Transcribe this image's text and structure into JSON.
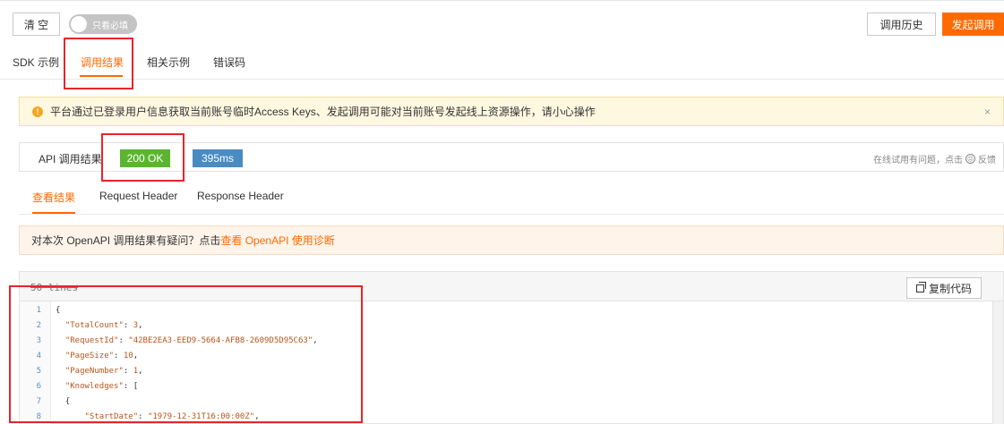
{
  "toolbar": {
    "clear_label": "清 空",
    "toggle_label": "只看必填",
    "history_label": "调用历史",
    "invoke_label": "发起调用"
  },
  "main_tabs": [
    "SDK 示例",
    "调用结果",
    "相关示例",
    "错误码"
  ],
  "warning": {
    "text": "平台通过已登录用户信息获取当前账号临时Access Keys、发起调用可能对当前账号发起线上资源操作，请小心操作",
    "close": "×"
  },
  "result": {
    "label": "API 调用结果",
    "status": "200 OK",
    "duration": "395ms",
    "feedback_prefix": "在线试用有问题，点击",
    "feedback_link": "反馈"
  },
  "sub_tabs": [
    "查看结果",
    "Request Header",
    "Response Header"
  ],
  "diagnosis": {
    "text": "对本次 OpenAPI 调用结果有疑问？点击",
    "link": "查看 OpenAPI 使用诊断"
  },
  "code": {
    "lines_label": "50 lines",
    "copy_label": "复制代码",
    "lines": [
      {
        "num": "1",
        "text": "{"
      },
      {
        "num": "2",
        "key": "\"TotalCount\"",
        "value": "3",
        "suffix": ","
      },
      {
        "num": "3",
        "key": "\"RequestId\"",
        "value": "\"42BE2EA3-EED9-5664-AFB8-2609D5D95C63\"",
        "suffix": ","
      },
      {
        "num": "4",
        "key": "\"PageSize\"",
        "value": "10",
        "suffix": ","
      },
      {
        "num": "5",
        "key": "\"PageNumber\"",
        "value": "1",
        "suffix": ","
      },
      {
        "num": "6",
        "key": "\"Knowledges\"",
        "value": "[",
        "suffix": ""
      },
      {
        "num": "7",
        "text": "  {"
      },
      {
        "num": "8",
        "key": "\"StartDate\"",
        "value": "\"1979-12-31T16:00:00Z\"",
        "suffix": ","
      }
    ]
  },
  "colors": {
    "accent": "#ff6a00",
    "status_ok": "#5cb531",
    "status_time": "#4a8bc2",
    "highlight_box": "#e8242a"
  }
}
